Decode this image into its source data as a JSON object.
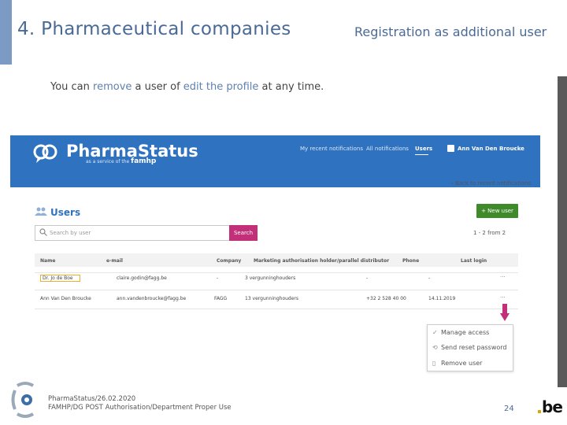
{
  "slide": {
    "title": "4. Pharmaceutical companies",
    "subtitle": "Registration as additional user",
    "intro_prefix": "You can ",
    "intro_link1": "remove",
    "intro_mid": " a user of ",
    "intro_link2": "edit the profile",
    "intro_suffix": " at any time."
  },
  "app": {
    "logo_text": "PharmaStatus",
    "logo_tag": "as a service of the",
    "logo_tag_brand": "famhp",
    "nav": {
      "notifications": "My recent notifications",
      "all_notifications": "All notifications",
      "users": "Users"
    },
    "current_user": "Ann Van Den Broucke",
    "back_link": "‹ Back to recent notifications",
    "page_heading": "Users",
    "new_user_button": "+ New user",
    "search": {
      "placeholder": "Search by user",
      "button": "Search"
    },
    "pagination": "1 - 2 from 2",
    "table": {
      "columns": [
        "Name",
        "e-mail",
        "Company",
        "Marketing authorisation holder/parallel distributor",
        "Phone",
        "Last login"
      ],
      "rows": [
        {
          "name": "Dr. Jo de Boe",
          "email": "claire.godin@fagg.be",
          "company": "-",
          "mah": "3 vergunninghouders",
          "phone": "-",
          "last_login": "-",
          "menu": "···"
        },
        {
          "name": "Ann Van Den Broucke",
          "email": "ann.vandenbroucke@fagg.be",
          "company": "FAGG",
          "mah": "13 vergunninghouders",
          "phone": "+32 2 528 40 00",
          "last_login": "14.11.2019",
          "menu": "···"
        }
      ]
    },
    "dropdown": {
      "items": [
        {
          "icon": "check-icon",
          "glyph": "✓",
          "label": "Manage access"
        },
        {
          "icon": "reset-icon",
          "glyph": "⟲",
          "label": "Send reset password"
        },
        {
          "icon": "delete-icon",
          "glyph": "▯",
          "label": "Remove user"
        }
      ]
    }
  },
  "footer": {
    "line1": "PharmaStatus/26.02.2020",
    "line2": "FAMHP/DG POST Authorisation/Department Proper Use",
    "page_number": "24",
    "be_logo": "be"
  },
  "colors": {
    "header_blue": "#2f72c0",
    "title_blue": "#4a6a96",
    "search_button": "#c3307a",
    "new_user_button": "#3f8a2a",
    "arrow": "#c3307a",
    "highlight_box": "#e8b12a"
  }
}
